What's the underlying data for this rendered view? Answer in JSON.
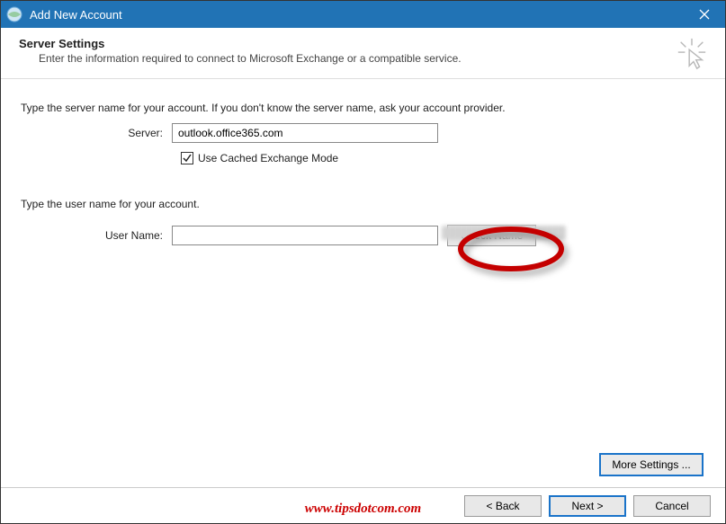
{
  "title": "Add New Account",
  "header": {
    "title": "Server Settings",
    "subtitle": "Enter the information required to connect to Microsoft Exchange or a compatible service."
  },
  "server_section": {
    "lead": "Type the server name for your account. If you don't know the server name, ask your account provider.",
    "server_label": "Server:",
    "server_value": "outlook.office365.com",
    "cached_label": "Use Cached Exchange Mode",
    "cached_checked": true
  },
  "user_section": {
    "lead": "Type the user name for your account.",
    "user_label": "User Name:",
    "user_value": "",
    "check_name_label": "Check Name"
  },
  "buttons": {
    "more_settings": "More Settings ...",
    "back": "< Back",
    "next": "Next >",
    "cancel": "Cancel"
  },
  "watermark": "www.tipsdotcom.com"
}
